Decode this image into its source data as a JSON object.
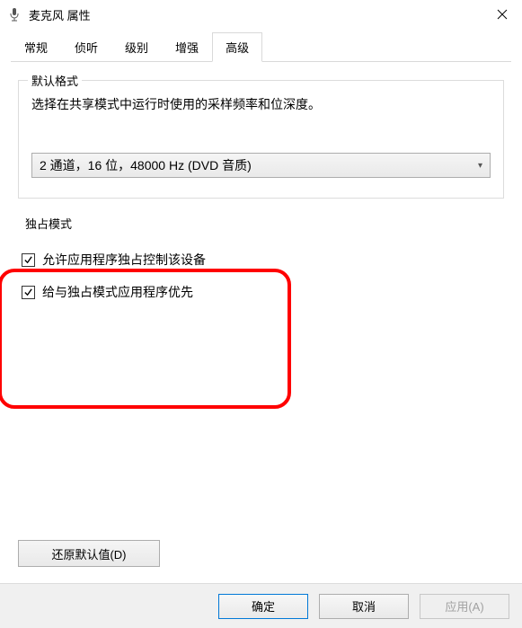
{
  "window": {
    "title": "麦克风 属性"
  },
  "tabs": {
    "items": [
      {
        "label": "常规"
      },
      {
        "label": "侦听"
      },
      {
        "label": "级别"
      },
      {
        "label": "增强"
      },
      {
        "label": "高级"
      }
    ],
    "activeIndex": 4
  },
  "defaultFormat": {
    "legend": "默认格式",
    "description": "选择在共享模式中运行时使用的采样频率和位深度。",
    "selected": "2 通道，16 位，48000 Hz (DVD 音质)"
  },
  "exclusive": {
    "legend": "独占模式",
    "checkboxes": [
      {
        "label": "允许应用程序独占控制该设备",
        "checked": true
      },
      {
        "label": "给与独占模式应用程序优先",
        "checked": true
      }
    ]
  },
  "buttons": {
    "restore": "还原默认值(D)",
    "ok": "确定",
    "cancel": "取消",
    "apply": "应用(A)"
  }
}
